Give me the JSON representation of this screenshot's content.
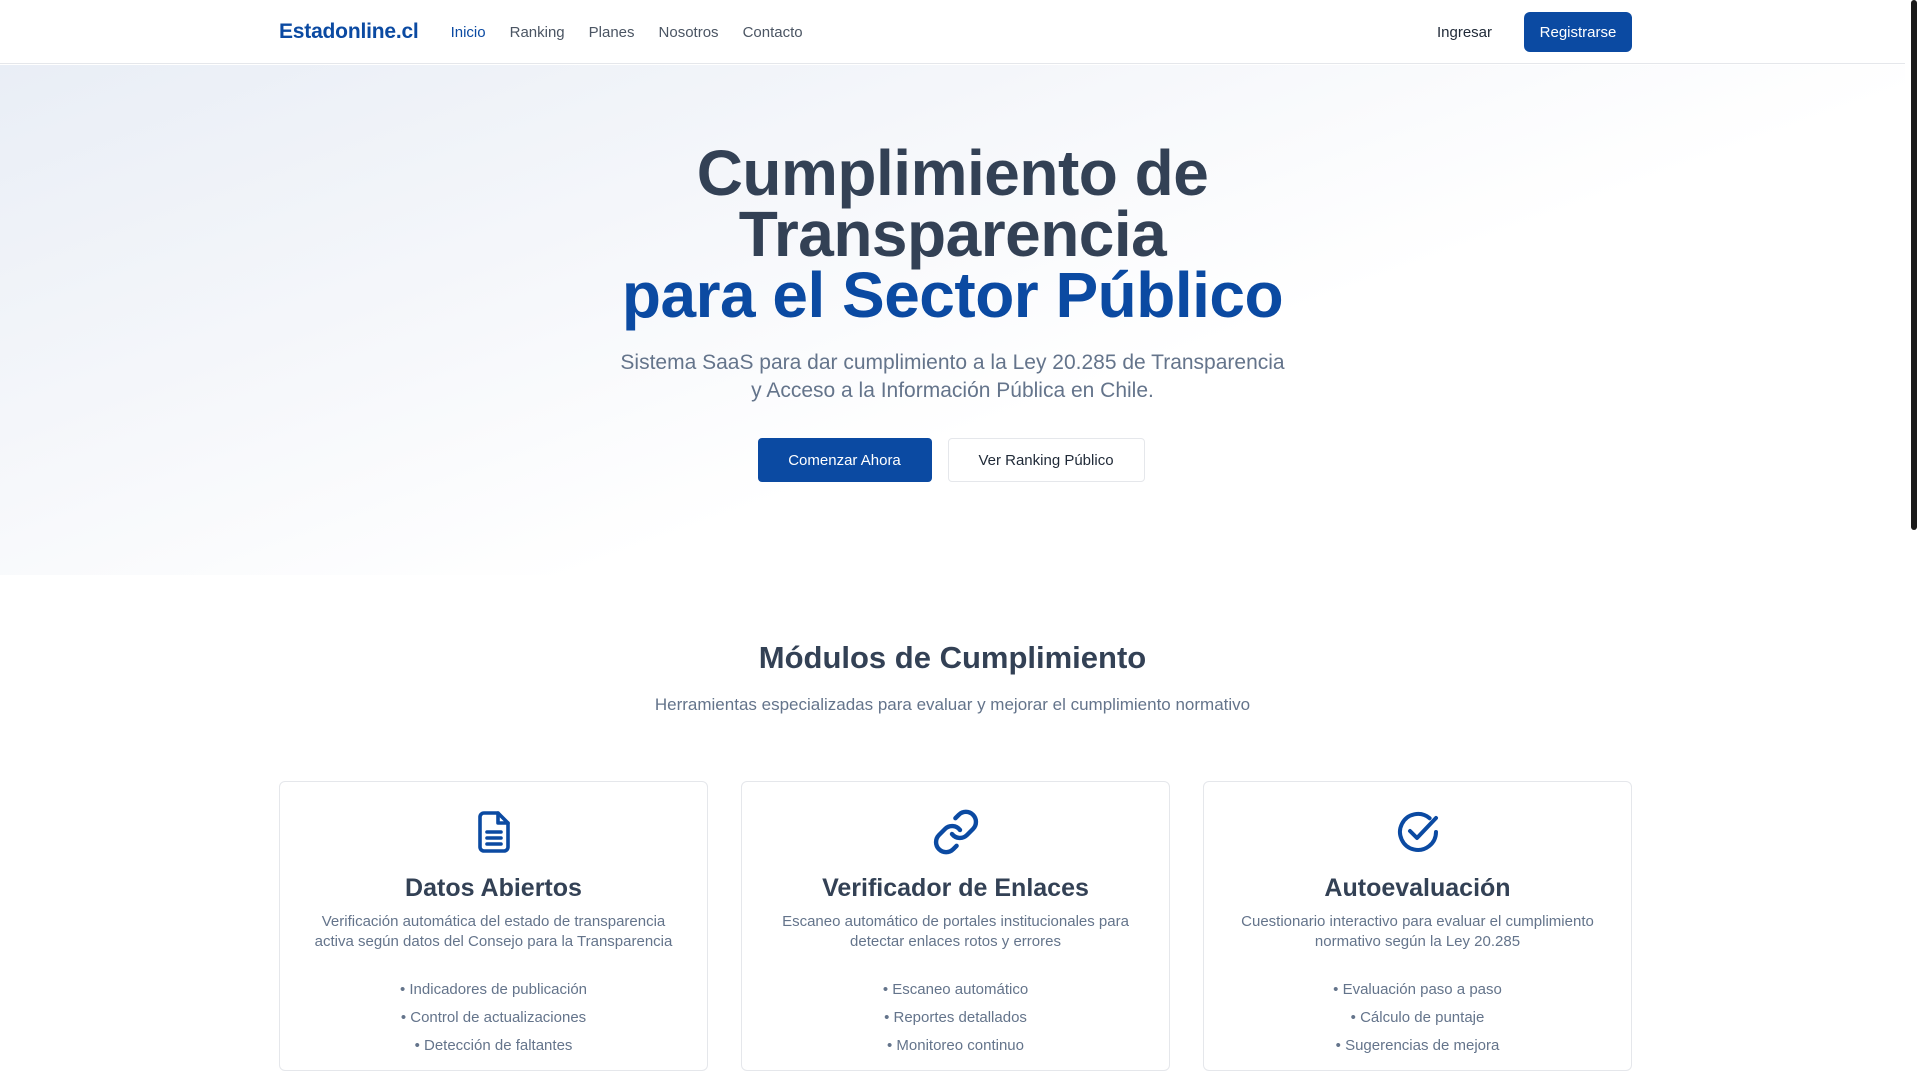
{
  "navbar": {
    "brand": "Estadonline.cl",
    "links": [
      {
        "label": "Inicio",
        "active": true
      },
      {
        "label": "Ranking",
        "active": false
      },
      {
        "label": "Planes",
        "active": false
      },
      {
        "label": "Nosotros",
        "active": false
      },
      {
        "label": "Contacto",
        "active": false
      }
    ],
    "login_label": "Ingresar",
    "register_label": "Registrarse"
  },
  "hero": {
    "title_line1": "Cumplimiento de",
    "title_line2": "Transparencia",
    "title_line3": "para el Sector Público",
    "subtitle_line1": "Sistema SaaS para dar cumplimiento a la Ley 20.285 de Transparencia",
    "subtitle_line2": "y Acceso a la Información Pública en Chile.",
    "primary_cta": "Comenzar Ahora",
    "secondary_cta": "Ver Ranking Público"
  },
  "modules": {
    "title": "Módulos de Cumplimiento",
    "subtitle": "Herramientas especializadas para evaluar y mejorar el cumplimiento normativo",
    "cards": [
      {
        "icon": "document-icon",
        "title": "Datos Abiertos",
        "description": "Verificación automática del estado de transparencia activa según datos del Consejo para la Transparencia",
        "features": [
          "Indicadores de publicación",
          "Control de actualizaciones",
          "Detección de faltantes"
        ]
      },
      {
        "icon": "link-icon",
        "title": "Verificador de Enlaces",
        "description": "Escaneo automático de portales institucionales para detectar enlaces rotos y errores",
        "features": [
          "Escaneo automático",
          "Reportes detallados",
          "Monitoreo continuo"
        ]
      },
      {
        "icon": "check-circle-icon",
        "title": "Autoevaluación",
        "description": "Cuestionario interactivo para evaluar el cumplimiento normativo según la Ley 20.285",
        "features": [
          "Evaluación paso a paso",
          "Cálculo de puntaje",
          "Sugerencias de mejora"
        ]
      }
    ]
  },
  "colors": {
    "brand": "#0b4aa2",
    "heading": "#334155",
    "muted": "#64748b",
    "border": "#e5e7eb"
  }
}
